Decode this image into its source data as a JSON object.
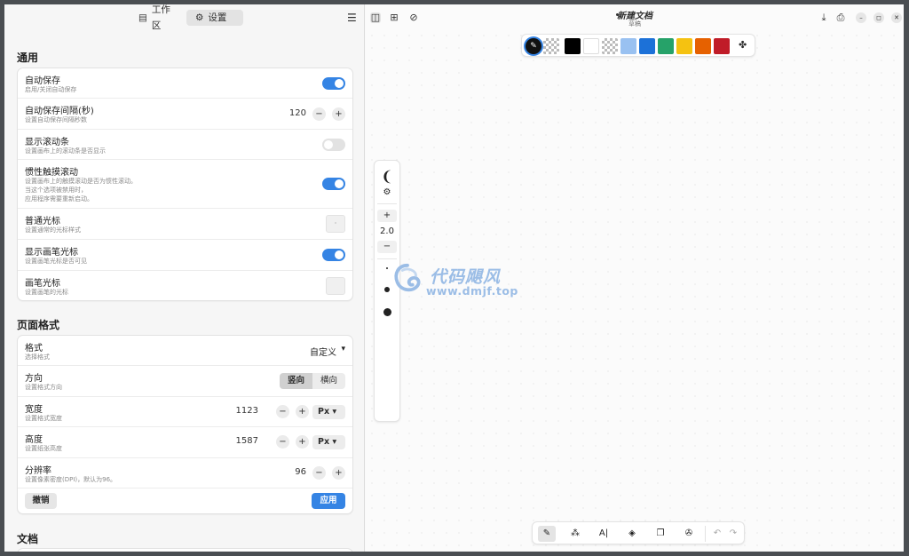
{
  "left_header": {
    "workspace_label": "工作区",
    "workspace_icon": "document-icon",
    "settings_label": "设置",
    "settings_icon": "gear-icon",
    "menu_icon": "≡"
  },
  "general": {
    "title": "通用",
    "autosave": {
      "title": "自动保存",
      "subtitle": "启用/关闭自动保存",
      "on": true
    },
    "autosave_interval": {
      "title": "自动保存间隔(秒)",
      "subtitle": "设置自动保存间隔秒数",
      "value": "120"
    },
    "scrollbars": {
      "title": "显示滚动条",
      "subtitle": "设置画布上的滚动条是否显示",
      "on": false
    },
    "inertia": {
      "title": "惯性触摸滚动",
      "subtitle_lines": [
        "设置画布上的触摸滚动是否为惯性滚动。",
        "当这个选项被禁用时，",
        "应用程序需要重新启动。"
      ],
      "on": true
    },
    "normal_cursor": {
      "title": "普通光标",
      "subtitle": "设置通常的光标样式",
      "glyph": "·"
    },
    "pen_cursor_visible": {
      "title": "显示画笔光标",
      "subtitle": "设置画笔光标是否可见",
      "on": true
    },
    "pen_cursor": {
      "title": "画笔光标",
      "subtitle": "设置画笔的光标"
    }
  },
  "page_format": {
    "title": "页面格式",
    "format": {
      "title": "格式",
      "subtitle": "选择格式",
      "value": "自定义",
      "caret": "▾"
    },
    "orientation": {
      "title": "方向",
      "subtitle": "设置格式方向",
      "portrait": "竖向",
      "landscape": "横向"
    },
    "width": {
      "title": "宽度",
      "subtitle": "设置格式宽度",
      "value": "1123",
      "unit": "Px"
    },
    "height": {
      "title": "高度",
      "subtitle": "设置纸张高度",
      "value": "1587",
      "unit": "Px"
    },
    "dpi": {
      "title": "分辨率",
      "subtitle": "设置像素密度(DPI)，默认为96。",
      "value": "96"
    },
    "cancel_label": "撤销",
    "apply_label": "应用"
  },
  "document": {
    "title": "文档"
  },
  "steppers": {
    "minus": "−",
    "plus": "+"
  },
  "right_header": {
    "doc_title": "新建文档",
    "doc_subtitle": "草稿"
  },
  "palette": {
    "colors": [
      "#000000",
      "#ffffff",
      "checker",
      "#99c1f1",
      "#1c71d8",
      "#26a269",
      "#f5c211",
      "#e66100",
      "#c01c28"
    ]
  },
  "sidetool": {
    "stroke_width": "2.0",
    "plus": "+",
    "minus": "−"
  },
  "watermark": {
    "line1": "代码飓风",
    "line2": "www.dmjf.top"
  },
  "accent_color": "#3584e4"
}
